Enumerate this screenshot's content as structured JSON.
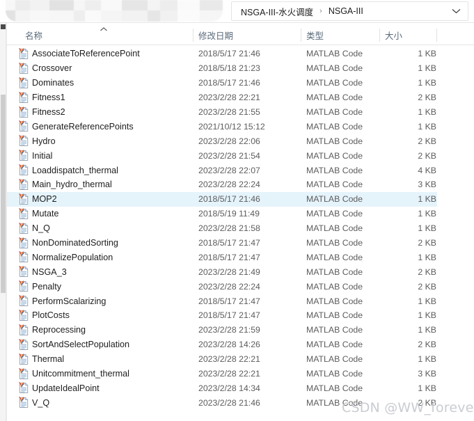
{
  "window": {
    "redacted_note": "",
    "address": {
      "crumbs": [
        "NSGA-III-水火调度",
        "NSGA-III"
      ],
      "separator": "›",
      "dropdown_icon": "chevron-down-icon"
    }
  },
  "columns": {
    "name": "名称",
    "date_modified": "修改日期",
    "type": "类型",
    "size": "大小",
    "sort_indicator": "chevron-up-icon"
  },
  "selection": {
    "selected_name": "MOP2",
    "highlight_color": "#e5f3fb"
  },
  "files": [
    {
      "name": "AssociateToReferencePoint",
      "date": "2018/5/17 21:46",
      "type": "MATLAB Code",
      "size": "1 KB",
      "selected": false
    },
    {
      "name": "Crossover",
      "date": "2018/5/18 21:23",
      "type": "MATLAB Code",
      "size": "1 KB",
      "selected": false
    },
    {
      "name": "Dominates",
      "date": "2018/5/17 21:46",
      "type": "MATLAB Code",
      "size": "1 KB",
      "selected": false
    },
    {
      "name": "Fitness1",
      "date": "2023/2/28 22:21",
      "type": "MATLAB Code",
      "size": "2 KB",
      "selected": false
    },
    {
      "name": "Fitness2",
      "date": "2023/2/28 21:55",
      "type": "MATLAB Code",
      "size": "1 KB",
      "selected": false
    },
    {
      "name": "GenerateReferencePoints",
      "date": "2021/10/12 15:12",
      "type": "MATLAB Code",
      "size": "1 KB",
      "selected": false
    },
    {
      "name": "Hydro",
      "date": "2023/2/28 22:06",
      "type": "MATLAB Code",
      "size": "2 KB",
      "selected": false
    },
    {
      "name": "Initial",
      "date": "2023/2/28 21:54",
      "type": "MATLAB Code",
      "size": "2 KB",
      "selected": false
    },
    {
      "name": "Loaddispatch_thermal",
      "date": "2023/2/28 22:07",
      "type": "MATLAB Code",
      "size": "4 KB",
      "selected": false
    },
    {
      "name": "Main_hydro_thermal",
      "date": "2023/2/28 22:24",
      "type": "MATLAB Code",
      "size": "3 KB",
      "selected": false
    },
    {
      "name": "MOP2",
      "date": "2018/5/17 21:46",
      "type": "MATLAB Code",
      "size": "1 KB",
      "selected": true
    },
    {
      "name": "Mutate",
      "date": "2018/5/19 11:49",
      "type": "MATLAB Code",
      "size": "1 KB",
      "selected": false
    },
    {
      "name": "N_Q",
      "date": "2023/2/28 21:58",
      "type": "MATLAB Code",
      "size": "1 KB",
      "selected": false
    },
    {
      "name": "NonDominatedSorting",
      "date": "2018/5/17 21:47",
      "type": "MATLAB Code",
      "size": "2 KB",
      "selected": false
    },
    {
      "name": "NormalizePopulation",
      "date": "2018/5/17 21:47",
      "type": "MATLAB Code",
      "size": "1 KB",
      "selected": false
    },
    {
      "name": "NSGA_3",
      "date": "2023/2/28 21:49",
      "type": "MATLAB Code",
      "size": "2 KB",
      "selected": false
    },
    {
      "name": "Penalty",
      "date": "2023/2/28 22:24",
      "type": "MATLAB Code",
      "size": "2 KB",
      "selected": false
    },
    {
      "name": "PerformScalarizing",
      "date": "2018/5/17 21:47",
      "type": "MATLAB Code",
      "size": "1 KB",
      "selected": false
    },
    {
      "name": "PlotCosts",
      "date": "2018/5/17 21:47",
      "type": "MATLAB Code",
      "size": "1 KB",
      "selected": false
    },
    {
      "name": "Reprocessing",
      "date": "2023/2/28 21:59",
      "type": "MATLAB Code",
      "size": "1 KB",
      "selected": false
    },
    {
      "name": "SortAndSelectPopulation",
      "date": "2023/2/28 14:26",
      "type": "MATLAB Code",
      "size": "2 KB",
      "selected": false
    },
    {
      "name": "Thermal",
      "date": "2023/2/28 22:21",
      "type": "MATLAB Code",
      "size": "1 KB",
      "selected": false
    },
    {
      "name": "Unitcommitment_thermal",
      "date": "2023/2/28 22:21",
      "type": "MATLAB Code",
      "size": "3 KB",
      "selected": false
    },
    {
      "name": "UpdateIdealPoint",
      "date": "2023/2/28 14:34",
      "type": "MATLAB Code",
      "size": "1 KB",
      "selected": false
    },
    {
      "name": "V_Q",
      "date": "2023/2/28 21:46",
      "type": "MATLAB Code",
      "size": "2 KB",
      "selected": false
    }
  ],
  "watermark": {
    "text": "CSDN @WW_forever",
    "color": "#c9ccd1"
  }
}
